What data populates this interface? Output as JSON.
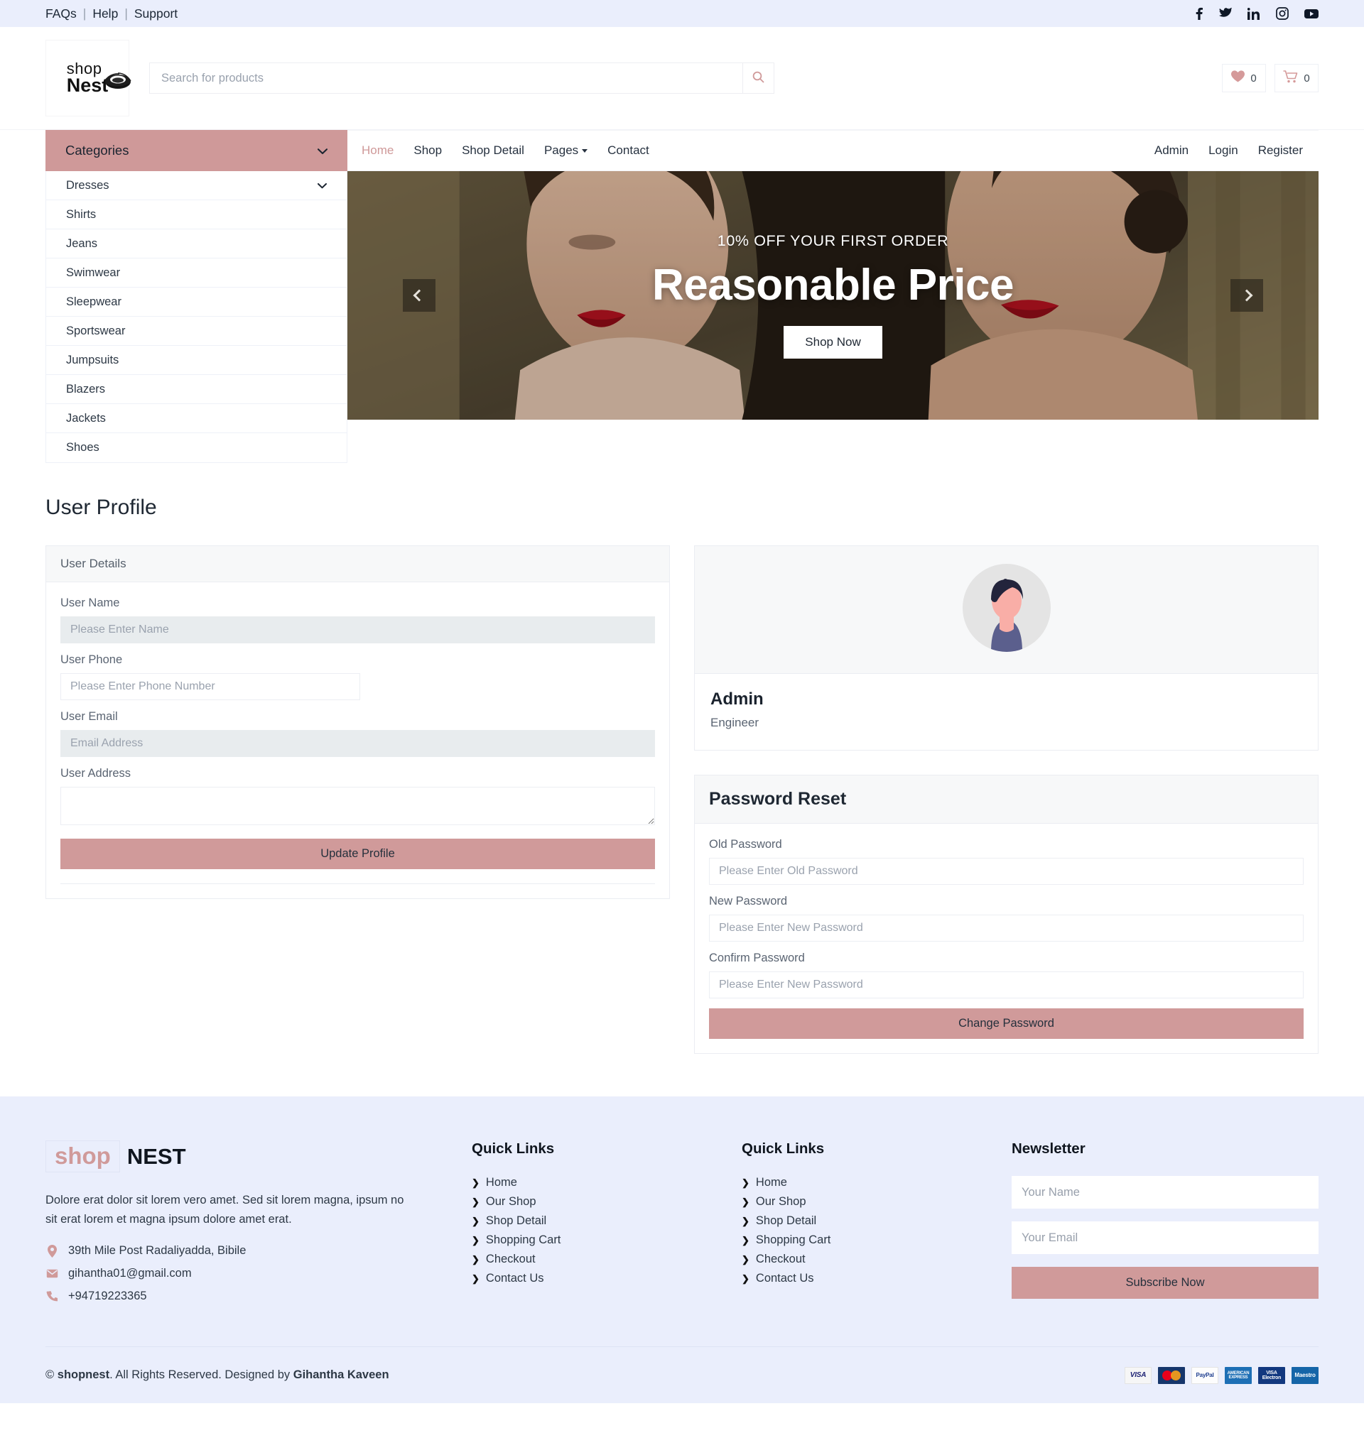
{
  "topbar": {
    "links": [
      "FAQs",
      "Help",
      "Support"
    ],
    "separator": "|",
    "social": [
      "facebook-icon",
      "twitter-icon",
      "linkedin-icon",
      "instagram-icon",
      "youtube-icon"
    ]
  },
  "header": {
    "logo": {
      "shop": "shop",
      "nest": "Nest",
      "glyph": "nest-icon"
    },
    "search": {
      "placeholder": "Search for products",
      "value": "",
      "icon": "search-icon"
    },
    "wishlist": {
      "icon": "heart-icon",
      "count": "0"
    },
    "cart": {
      "icon": "cart-icon",
      "count": "0"
    }
  },
  "categories": {
    "toggle_label": "Categories",
    "toggle_icon": "chevron-down-icon",
    "items": [
      {
        "label": "Dresses",
        "has_chevron": true
      },
      {
        "label": "Shirts",
        "has_chevron": false
      },
      {
        "label": "Jeans",
        "has_chevron": false
      },
      {
        "label": "Swimwear",
        "has_chevron": false
      },
      {
        "label": "Sleepwear",
        "has_chevron": false
      },
      {
        "label": "Sportswear",
        "has_chevron": false
      },
      {
        "label": "Jumpsuits",
        "has_chevron": false
      },
      {
        "label": "Blazers",
        "has_chevron": false
      },
      {
        "label": "Jackets",
        "has_chevron": false
      },
      {
        "label": "Shoes",
        "has_chevron": false
      }
    ]
  },
  "nav": {
    "left": [
      {
        "label": "Home",
        "active": true,
        "dropdown": false
      },
      {
        "label": "Shop",
        "active": false,
        "dropdown": false
      },
      {
        "label": "Shop Detail",
        "active": false,
        "dropdown": false
      },
      {
        "label": "Pages",
        "active": false,
        "dropdown": true
      },
      {
        "label": "Contact",
        "active": false,
        "dropdown": false
      }
    ],
    "right": [
      {
        "label": "Admin"
      },
      {
        "label": "Login"
      },
      {
        "label": "Register"
      }
    ]
  },
  "hero": {
    "kicker": "10% OFF YOUR FIRST ORDER",
    "title": "Reasonable Price",
    "button": "Shop Now",
    "prev_icon": "chevron-left-icon",
    "next_icon": "chevron-right-icon"
  },
  "profile": {
    "page_title": "User Profile",
    "details_card": {
      "header": "User Details",
      "fields": [
        {
          "label": "User Name",
          "placeholder": "Please Enter Name",
          "value": "",
          "disabled": true,
          "type": "text",
          "full": true
        },
        {
          "label": "User Phone",
          "placeholder": "Please Enter Phone Number",
          "value": "",
          "disabled": false,
          "type": "text",
          "full": false
        },
        {
          "label": "User Email",
          "placeholder": "Email Address",
          "value": "",
          "disabled": true,
          "type": "text",
          "full": true
        },
        {
          "label": "User Address",
          "placeholder": "",
          "value": "",
          "disabled": false,
          "type": "textarea",
          "full": true
        }
      ],
      "submit_label": "Update Profile"
    },
    "user_card": {
      "avatar_icon": "user-avatar-icon",
      "name": "Admin",
      "role": "Engineer"
    },
    "password_card": {
      "header": "Password Reset",
      "fields": [
        {
          "label": "Old Password",
          "placeholder": "Please Enter Old Password",
          "value": ""
        },
        {
          "label": "New Password",
          "placeholder": "Please Enter New Password",
          "value": ""
        },
        {
          "label": "Confirm Password",
          "placeholder": "Please Enter New Password",
          "value": ""
        }
      ],
      "submit_label": "Change Password"
    }
  },
  "footer": {
    "brand": {
      "shop": "shop",
      "nest": "NEST"
    },
    "description": "Dolore erat dolor sit lorem vero amet. Sed sit lorem magna, ipsum no sit erat lorem et magna ipsum dolore amet erat.",
    "contact": [
      {
        "icon": "map-marker-icon",
        "text": "39th Mile Post Radaliyadda, Bibile"
      },
      {
        "icon": "envelope-icon",
        "text": "gihantha01@gmail.com"
      },
      {
        "icon": "phone-icon",
        "text": "+94719223365"
      }
    ],
    "quick_links_1": {
      "title": "Quick Links",
      "items": [
        "Home",
        "Our Shop",
        "Shop Detail",
        "Shopping Cart",
        "Checkout",
        "Contact Us"
      ]
    },
    "quick_links_2": {
      "title": "Quick Links",
      "items": [
        "Home",
        "Our Shop",
        "Shop Detail",
        "Shopping Cart",
        "Checkout",
        "Contact Us"
      ]
    },
    "newsletter": {
      "title": "Newsletter",
      "name_placeholder": "Your Name",
      "name_value": "",
      "email_placeholder": "Your Email",
      "email_value": "",
      "button": "Subscribe Now"
    },
    "bottom": {
      "copy_symbol": "©",
      "brand": "shopnest",
      "middle": ". All Rights Reserved. Designed by ",
      "designer": "Gihantha Kaveen",
      "payments": [
        "VISA",
        "MasterCard",
        "PayPal",
        "AMERICAN EXPRESS",
        "VISA Electron",
        "Maestro"
      ]
    }
  },
  "colors": {
    "accent": "#d09a9a",
    "accent_dark": "#cf9999",
    "topbar_bg": "#eaeefc",
    "footer_bg": "#eaeefc",
    "card_head_bg": "#f7f8f9",
    "disabled_input_bg": "#e8ecee"
  }
}
